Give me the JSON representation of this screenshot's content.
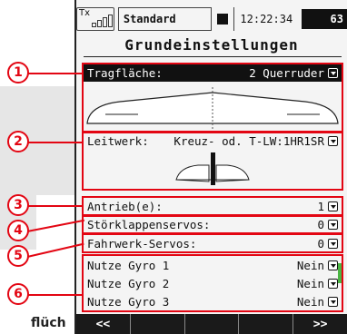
{
  "status": {
    "tx_label": "Tx",
    "model_name": "Standard",
    "clock": "12:22:34",
    "battery": "63"
  },
  "page_title": "Grundeinstellungen",
  "rows": {
    "tragflaeche": {
      "label": "Tragfläche:",
      "value": "2 Querruder"
    },
    "leitwerk": {
      "label": "Leitwerk:",
      "value": "Kreuz- od. T-LW:1HR1SR"
    },
    "antrieb": {
      "label": "Antrieb(e):",
      "value": "1"
    },
    "stoerklappen": {
      "label": "Störklappenservos:",
      "value": "0"
    },
    "fahrwerk": {
      "label": "Fahrwerk-Servos:",
      "value": "0"
    },
    "gyro1": {
      "label": "Nutze Gyro 1",
      "value": "Nein"
    },
    "gyro2": {
      "label": "Nutze Gyro 2",
      "value": "Nein"
    },
    "gyro3": {
      "label": "Nutze Gyro 3",
      "value": "Nein"
    }
  },
  "callouts": [
    "1",
    "2",
    "3",
    "4",
    "5",
    "6"
  ],
  "bottom_nav": {
    "prev": "<<",
    "next": ">>"
  },
  "corner_text": "flüch",
  "colors": {
    "callout_red": "#e30613",
    "selected_row": "#111111",
    "screen_bg": "#f4f4f4"
  }
}
